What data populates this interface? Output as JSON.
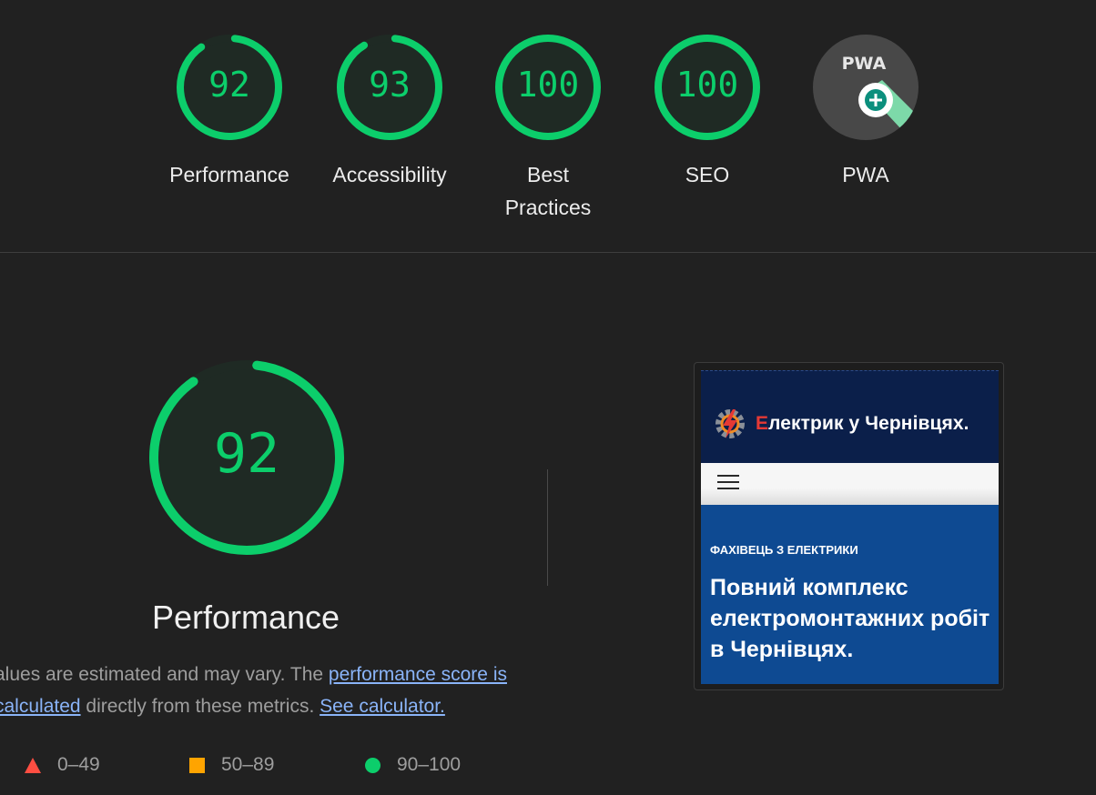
{
  "categories": [
    {
      "score": "92",
      "label": "Performance",
      "value": 92
    },
    {
      "score": "93",
      "label": "Accessibility",
      "value": 93
    },
    {
      "score": "100",
      "label": "Best Practices",
      "value": 100
    },
    {
      "score": "100",
      "label": "SEO",
      "value": 100
    },
    {
      "badge": "PWA",
      "label": "PWA"
    }
  ],
  "main": {
    "score": "92",
    "value": 92,
    "title": "Performance",
    "desc_prefix": "alues are estimated and may vary. The ",
    "link_score": "performance score is calculated",
    "desc_middle": " directly from these metrics. ",
    "link_calc": "See calculator."
  },
  "legend": [
    {
      "range": "0–49",
      "icon": "fail-triangle-icon",
      "color": "#ff4e42"
    },
    {
      "range": "50–89",
      "icon": "average-square-icon",
      "color": "#ffa400"
    },
    {
      "range": "90–100",
      "icon": "pass-circle-icon",
      "color": "#0cce6b"
    }
  ],
  "screenshot": {
    "site_name_first": "Е",
    "site_name_rest": "лектрик у Чернівцях.",
    "kicker": "ФАХІВЕЦЬ З ЕЛЕКТРИКИ",
    "headline": "Повний комплекс електромонтажних робіт в Чернівцях."
  },
  "colors": {
    "pass": "#0cce6b",
    "background": "#212121",
    "link": "#8ab4f8"
  }
}
